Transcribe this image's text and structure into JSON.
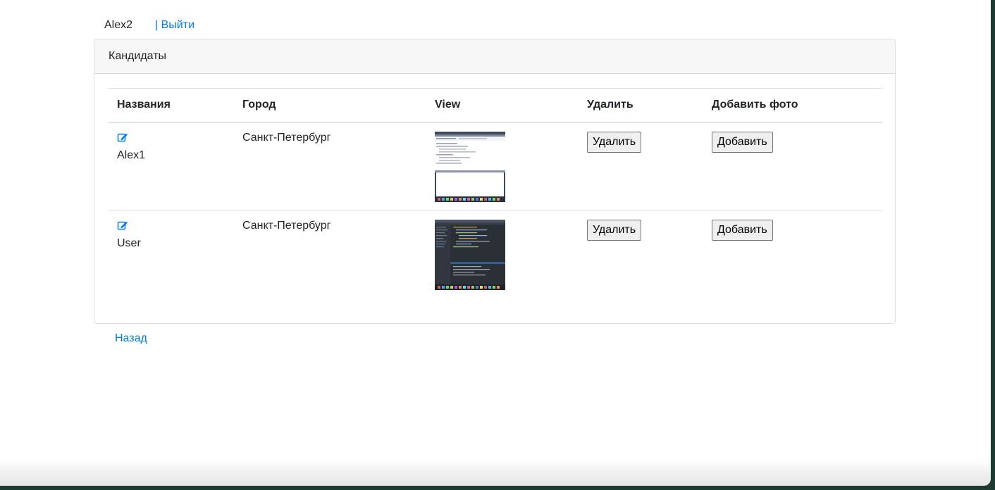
{
  "header": {
    "username": "Alex2",
    "logout_label": "| Выйти"
  },
  "card": {
    "title": "Кандидаты"
  },
  "table": {
    "columns": [
      "Названия",
      "Город",
      "View",
      "Удалить",
      "Добавить фото"
    ],
    "rows": [
      {
        "name": "Alex1",
        "city": "Санкт-Петербург",
        "thumbnail_style": "light",
        "delete_label": "Удалить",
        "add_label": "Добавить"
      },
      {
        "name": "User",
        "city": "Санкт-Петербург",
        "thumbnail_style": "dark",
        "delete_label": "Удалить",
        "add_label": "Добавить"
      }
    ]
  },
  "footer": {
    "back_label": "Назад"
  },
  "colors": {
    "link": "#007bff",
    "header_bg": "#f7f7f7",
    "desktop_bg": "#1e3a34"
  },
  "icons": {
    "edit": "edit-icon"
  }
}
